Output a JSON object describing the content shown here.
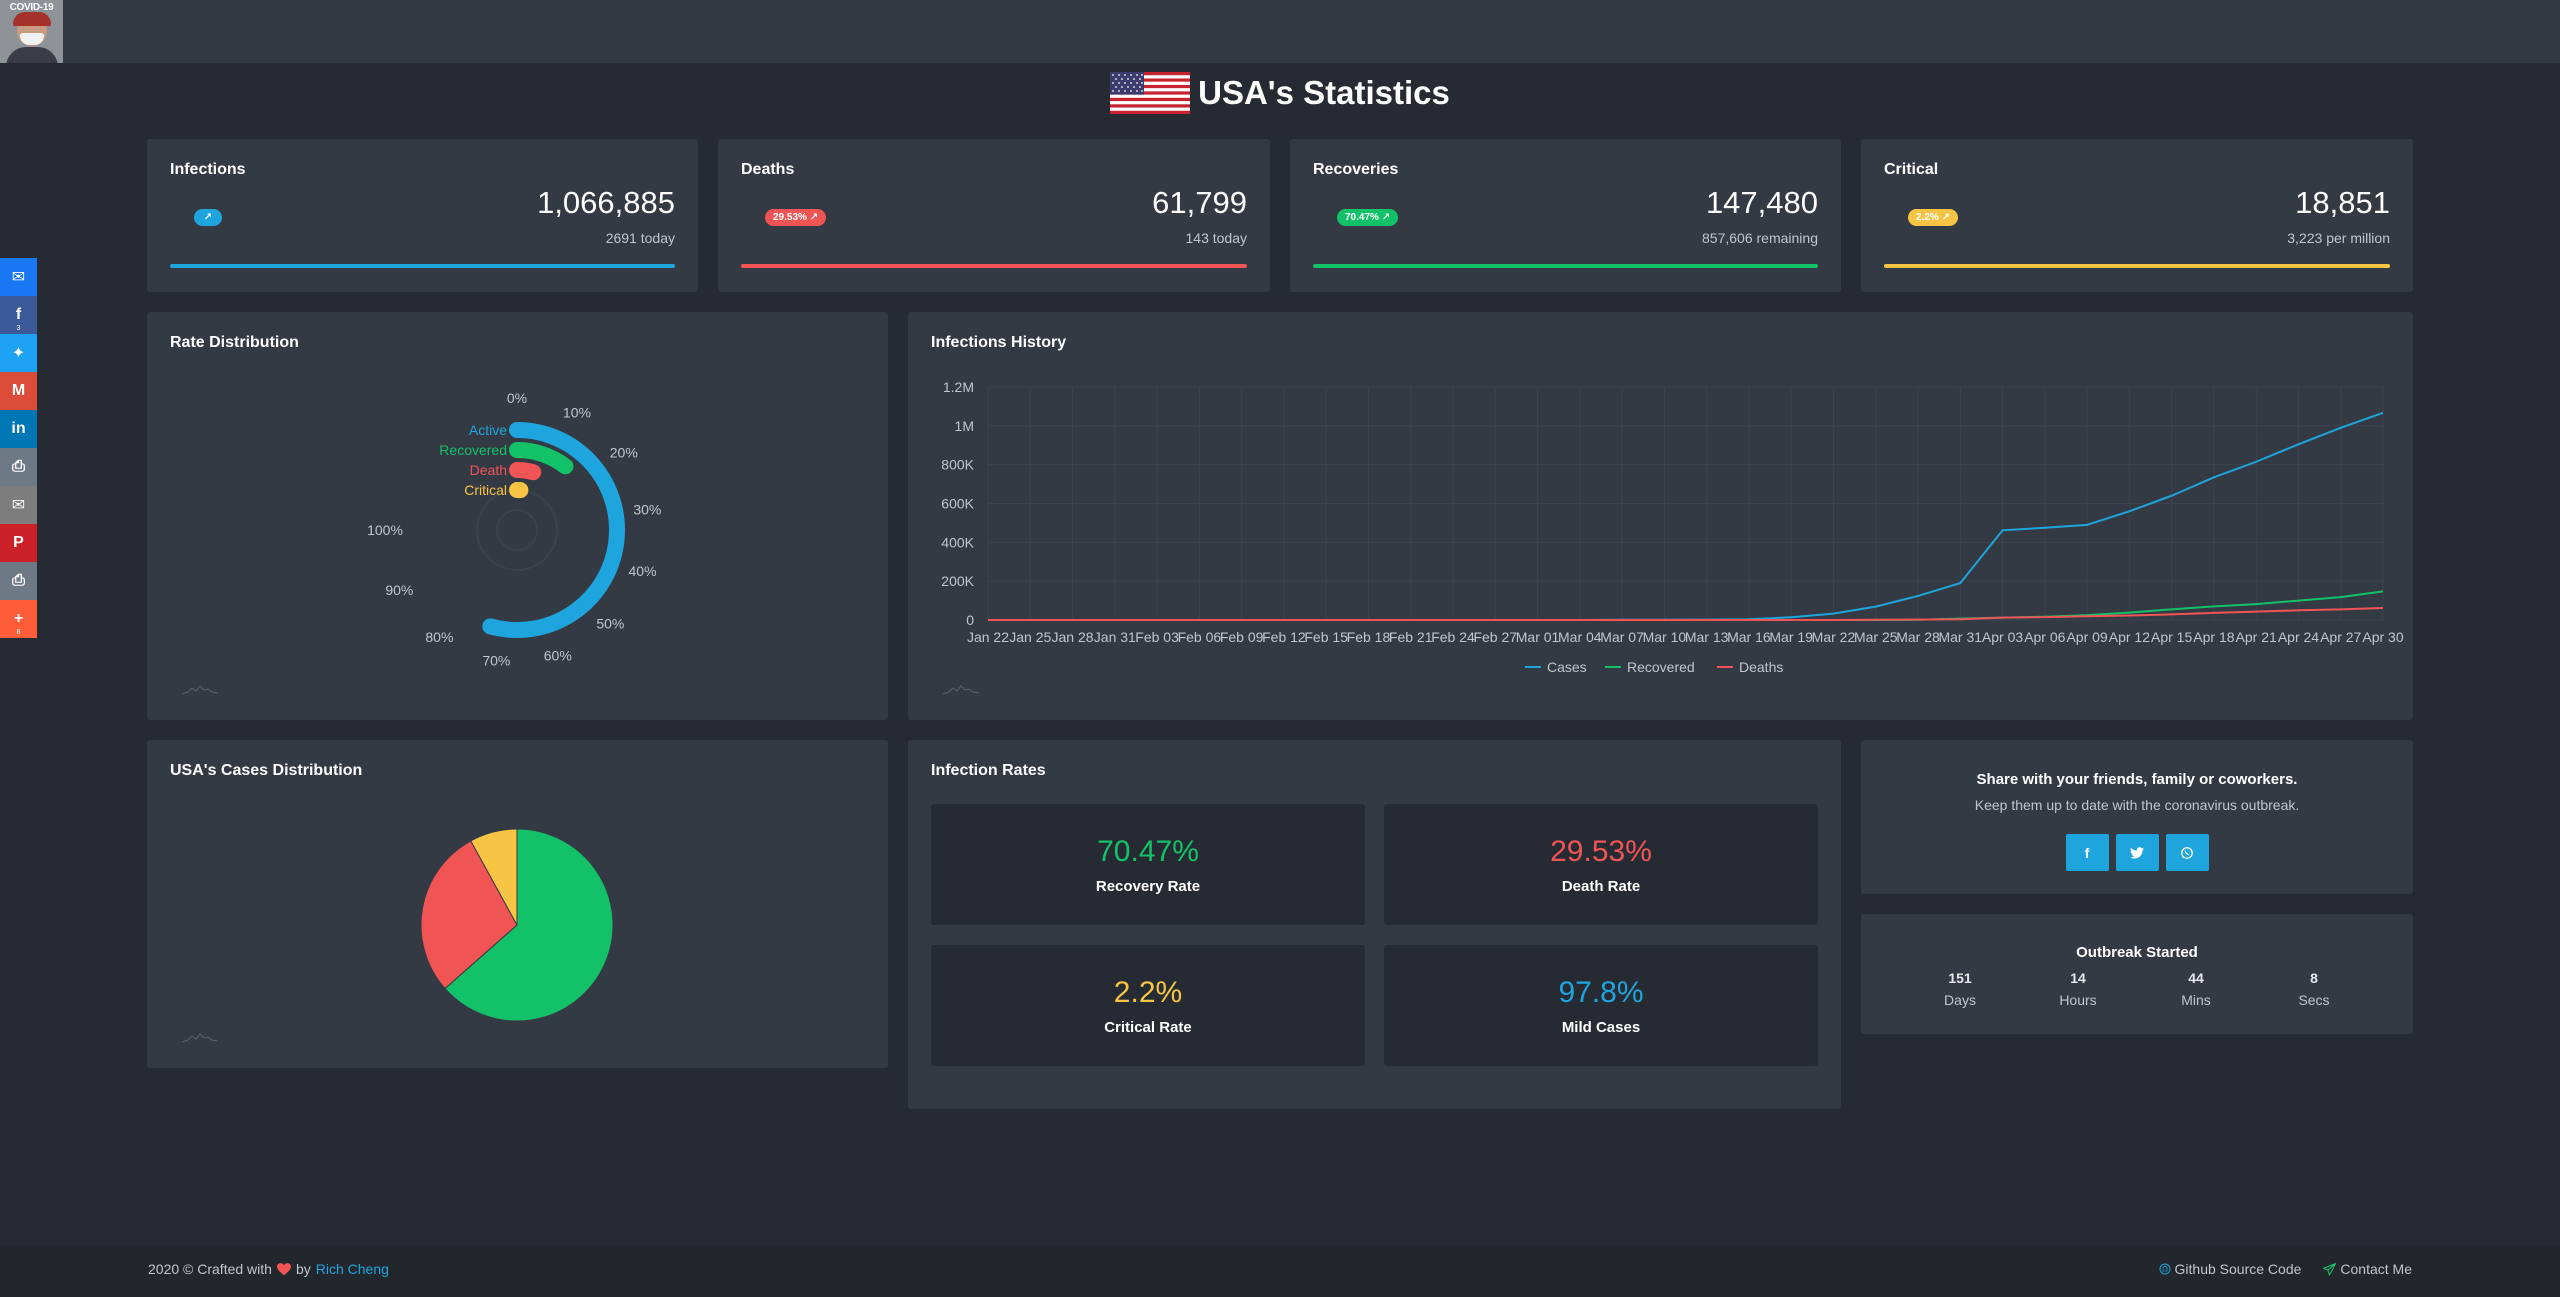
{
  "header": {
    "logo_text": "COVID-19",
    "title": "USA's Statistics"
  },
  "colors": {
    "infections": "#1ea5de",
    "deaths": "#f05455",
    "recoveries": "#13c268",
    "critical": "#f8c444",
    "background": "#262b33",
    "card": "#343a44"
  },
  "social_share": [
    {
      "icon": "messenger-icon",
      "color": "#1877f2",
      "count": ""
    },
    {
      "icon": "facebook-icon",
      "color": "#3b5998",
      "count": "3"
    },
    {
      "icon": "twitter-icon",
      "color": "#1da1f2",
      "count": ""
    },
    {
      "icon": "gmail-icon",
      "color": "#dd4b39",
      "count": ""
    },
    {
      "icon": "linkedin-icon",
      "color": "#0077b5",
      "count": ""
    },
    {
      "icon": "print-icon",
      "color": "#6d7a86",
      "count": ""
    },
    {
      "icon": "email-icon",
      "color": "#7d7d7d",
      "count": ""
    },
    {
      "icon": "pinterest-icon",
      "color": "#cb2027",
      "count": ""
    },
    {
      "icon": "printfriendly-icon",
      "color": "#6d7a86",
      "count": ""
    },
    {
      "icon": "more-icon",
      "color": "#ff5c3a",
      "count": "8"
    }
  ],
  "stats": [
    {
      "title": "Infections",
      "value": "1,066,885",
      "sub": "2691 today",
      "badge": "",
      "badge_color": "#1ea5de",
      "bar_color": "#1ea5de"
    },
    {
      "title": "Deaths",
      "value": "61,799",
      "sub": "143 today",
      "badge": "29.53%",
      "badge_color": "#f05455",
      "bar_color": "#f05455"
    },
    {
      "title": "Recoveries",
      "value": "147,480",
      "sub": "857,606 remaining",
      "badge": "70.47%",
      "badge_color": "#13c268",
      "bar_color": "#13c268"
    },
    {
      "title": "Critical",
      "value": "18,851",
      "sub": "3,223 per million",
      "badge": "2.2%",
      "badge_color": "#f8c444",
      "bar_color": "#f8c444"
    }
  ],
  "rate_distribution": {
    "title": "Rate Distribution"
  },
  "infections_history": {
    "title": "Infections History"
  },
  "cases_distribution": {
    "title": "USA's Cases Distribution"
  },
  "infection_rates": {
    "title": "Infection Rates",
    "items": [
      {
        "value": "70.47%",
        "label": "Recovery Rate",
        "color": "#13c268"
      },
      {
        "value": "29.53%",
        "label": "Death Rate",
        "color": "#f05455"
      },
      {
        "value": "2.2%",
        "label": "Critical Rate",
        "color": "#f8c444"
      },
      {
        "value": "97.8%",
        "label": "Mild Cases",
        "color": "#1ea5de"
      }
    ]
  },
  "share": {
    "title": "Share with your friends, family or coworkers.",
    "subtitle": "Keep them up to date with the coronavirus outbreak."
  },
  "outbreak": {
    "title": "Outbreak Started",
    "items": [
      {
        "num": "151",
        "unit": "Days"
      },
      {
        "num": "14",
        "unit": "Hours"
      },
      {
        "num": "44",
        "unit": "Mins"
      },
      {
        "num": "8",
        "unit": "Secs"
      }
    ]
  },
  "footer": {
    "left_prefix": "2020 © Crafted with",
    "left_by": "by",
    "author": "Rich Cheng",
    "github": "Github Source Code",
    "contact": "Contact Me"
  },
  "chart_data": [
    {
      "type": "radial-bar",
      "categories": [
        "Active",
        "Recovered",
        "Death",
        "Critical"
      ],
      "values": [
        72.4,
        13.8,
        5.8,
        1.8
      ],
      "colors": [
        "#1ea5de",
        "#13c268",
        "#f05455",
        "#f8c444"
      ],
      "tick_labels": [
        "0%",
        "10%",
        "20%",
        "30%",
        "40%",
        "50%",
        "60%",
        "70%",
        "80%",
        "90%",
        "100%"
      ],
      "range": [
        0,
        100
      ],
      "unit": "%"
    },
    {
      "type": "line",
      "x": [
        "Jan 22",
        "Jan 25",
        "Jan 28",
        "Jan 31",
        "Feb 03",
        "Feb 06",
        "Feb 09",
        "Feb 12",
        "Feb 15",
        "Feb 18",
        "Feb 21",
        "Feb 24",
        "Feb 27",
        "Mar 01",
        "Mar 04",
        "Mar 07",
        "Mar 10",
        "Mar 13",
        "Mar 16",
        "Mar 19",
        "Mar 22",
        "Mar 25",
        "Mar 28",
        "Mar 31",
        "Apr 03",
        "Apr 06",
        "Apr 09",
        "Apr 12",
        "Apr 15",
        "Apr 18",
        "Apr 21",
        "Apr 24",
        "Apr 27",
        "Apr 30"
      ],
      "series": [
        {
          "name": "Cases",
          "color": "#1ea5de",
          "values": [
            0,
            0,
            0,
            0,
            0,
            0,
            0,
            0,
            0,
            0,
            0,
            0,
            0,
            0,
            0,
            1000,
            1000,
            2000,
            4000,
            14000,
            33000,
            69000,
            124000,
            190000,
            462000,
            475000,
            490000,
            560000,
            640000,
            735000,
            815000,
            905000,
            990000,
            1066885
          ]
        },
        {
          "name": "Recovered",
          "color": "#13c268",
          "values": [
            0,
            0,
            0,
            0,
            0,
            0,
            0,
            0,
            0,
            0,
            0,
            0,
            0,
            0,
            0,
            0,
            0,
            0,
            0,
            0,
            0,
            0,
            1000,
            7000,
            12000,
            17000,
            25000,
            38000,
            55000,
            70000,
            82000,
            100000,
            118000,
            147480
          ]
        },
        {
          "name": "Deaths",
          "color": "#f05455",
          "values": [
            0,
            0,
            0,
            0,
            0,
            0,
            0,
            0,
            0,
            0,
            0,
            0,
            0,
            0,
            0,
            0,
            0,
            0,
            0,
            0,
            0,
            1000,
            2000,
            4000,
            12000,
            15000,
            19000,
            23000,
            29000,
            37000,
            43000,
            50000,
            55000,
            61799
          ]
        }
      ],
      "y_ticks": [
        "0",
        "200K",
        "400K",
        "600K",
        "800K",
        "1M",
        "1.2M"
      ],
      "ylim": [
        0,
        1200000
      ],
      "legend": "bottom-center"
    },
    {
      "type": "pie",
      "categories": [
        "Recovered",
        "Deaths",
        "Critical"
      ],
      "values": [
        63.5,
        28.5,
        8.0
      ],
      "colors": [
        "#13c268",
        "#f05455",
        "#f8c444"
      ]
    }
  ]
}
